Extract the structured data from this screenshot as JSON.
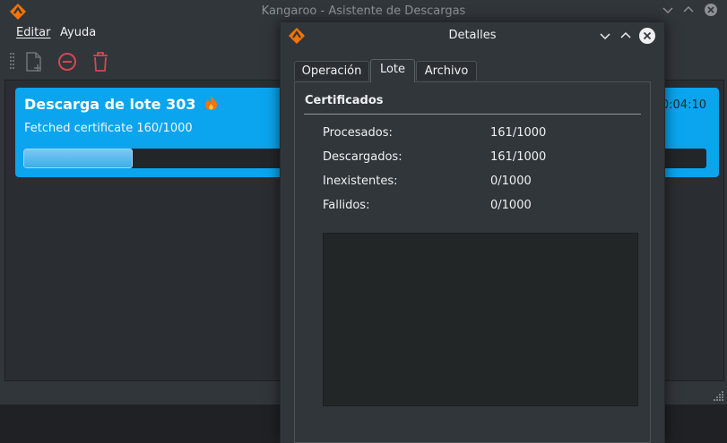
{
  "main_window": {
    "title": "Kangaroo - Asistente de Descargas",
    "menu": [
      {
        "label": "Editar",
        "mnemonic_index": 1
      },
      {
        "label": "Ayuda",
        "mnemonic_index": 1
      }
    ],
    "toolbar": {
      "icons": [
        "new-document-icon",
        "stop-icon",
        "delete-icon"
      ]
    },
    "job": {
      "title": "Descarga de lote 303",
      "status": "Fetched certificate 160/1000",
      "elapsed": "0:04:10",
      "progress": 0.16,
      "badge_icon": "fire-icon"
    }
  },
  "dialog": {
    "title": "Detalles",
    "tabs": [
      {
        "label": "Operación",
        "active": false
      },
      {
        "label": "Lote",
        "active": true
      },
      {
        "label": "Archivo",
        "active": false
      }
    ],
    "group_title": "Certificados",
    "stats": [
      {
        "label": "Procesados:",
        "value": "161/1000"
      },
      {
        "label": "Descargados:",
        "value": "161/1000"
      },
      {
        "label": "Inexistentes:",
        "value": "0/1000"
      },
      {
        "label": "Fallidos:",
        "value": "0/1000"
      }
    ]
  },
  "colors": {
    "accent": "#3daee9",
    "card": "#0aa5ee",
    "logo": "#f67400",
    "danger": "#da4453",
    "window_bg": "#31363b"
  }
}
